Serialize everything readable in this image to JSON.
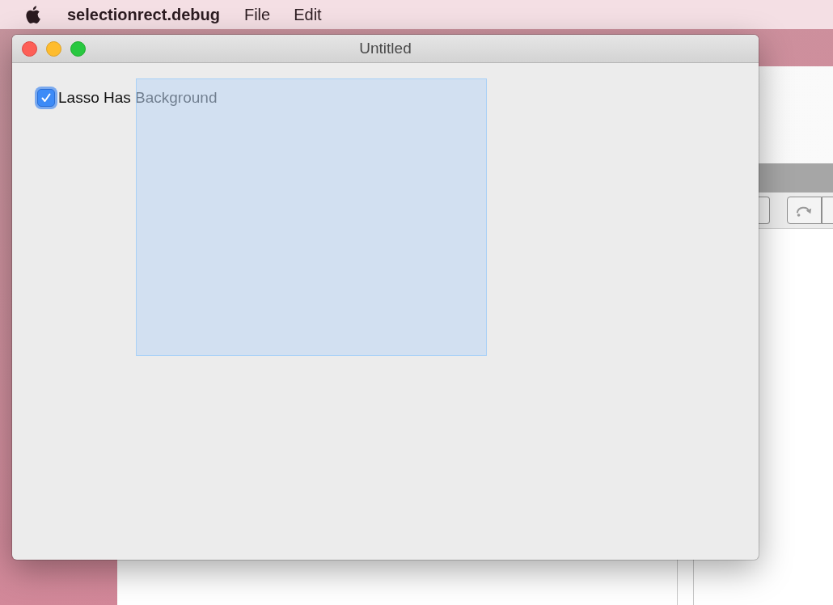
{
  "menu_bar": {
    "app_name": "selectionrect.debug",
    "items": [
      "File",
      "Edit"
    ]
  },
  "window": {
    "title": "Untitled",
    "checkbox": {
      "label": "Lasso Has Background",
      "checked": true
    }
  }
}
